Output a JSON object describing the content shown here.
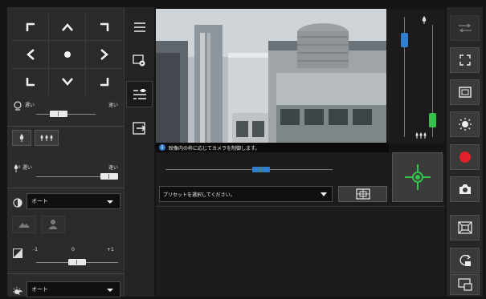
{
  "left_panel": {
    "pan_tilt": {
      "buttons": [
        "up-left",
        "up",
        "up-right",
        "left",
        "home",
        "right",
        "down-left",
        "down",
        "down-right"
      ]
    },
    "pan_speed": {
      "slow_label": "遅い",
      "fast_label": "速い",
      "level": 0.33
    },
    "focus": {
      "slow_label": "遅い",
      "fast_label": "速い",
      "level": 1.0
    },
    "mode_select": {
      "value": "オート"
    },
    "exposure": {
      "min_label": "-1",
      "mid_label": "0",
      "max_label": "+1",
      "level": 0.5
    },
    "day_night_select": {
      "value": "オート"
    }
  },
  "caption": {
    "info_icon": "i",
    "text": "映像内の枠に応じてカメラを制御します。"
  },
  "zoom": {
    "level": 0.15
  },
  "focus_slider": {
    "level": 0.9
  },
  "horizontal_slider": {
    "level": 0.58
  },
  "preset": {
    "placeholder": "プリセットを選択してください。"
  },
  "colors": {
    "accent_blue": "#2e7fcf",
    "accent_green": "#35c24a",
    "record_red": "#e0202a"
  },
  "right_toolbar": {
    "icons": [
      "swap-icon",
      "fullscreen-icon",
      "frame-icon",
      "brightness-icon",
      "record-icon",
      "snapshot-icon",
      "zoom-frame-icon",
      "rotate-zoom-icon",
      "pip-icon"
    ]
  }
}
